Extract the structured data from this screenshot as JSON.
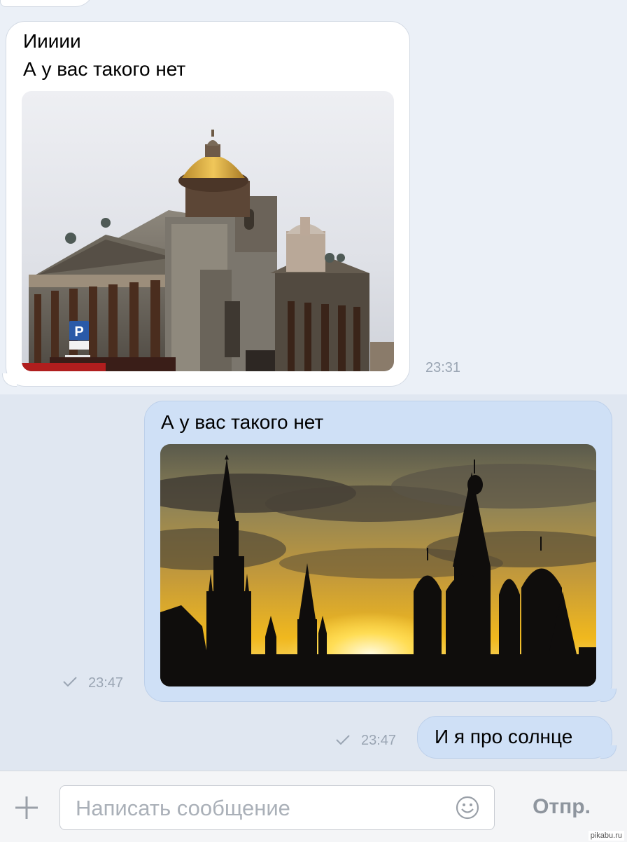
{
  "messages": [
    {
      "direction": "incoming",
      "text_lines": [
        "Иииии",
        "А у вас такого нет"
      ],
      "photo": "st-isaacs-cathedral-photo",
      "time": "23:31"
    },
    {
      "direction": "outgoing",
      "text": "А у вас такого нет",
      "photo": "moscow-kremlin-sunset-photo",
      "time": "23:47",
      "status_icon": "check-icon"
    },
    {
      "direction": "outgoing",
      "text": "И я про солнце",
      "time": "23:47",
      "status_icon": "check-icon"
    }
  ],
  "composer": {
    "attach_icon": "plus-icon",
    "placeholder": "Написать сообщение",
    "value": "",
    "emoji_icon": "smile-icon",
    "send_label": "Отпр."
  },
  "watermark": "pikabu.ru",
  "colors": {
    "incoming_bubble": "#ffffff",
    "outgoing_bubble": "#cfe0f6",
    "background": "#e6ecf4",
    "timestamp": "#9aa5b3",
    "send_text": "#8e959e"
  }
}
